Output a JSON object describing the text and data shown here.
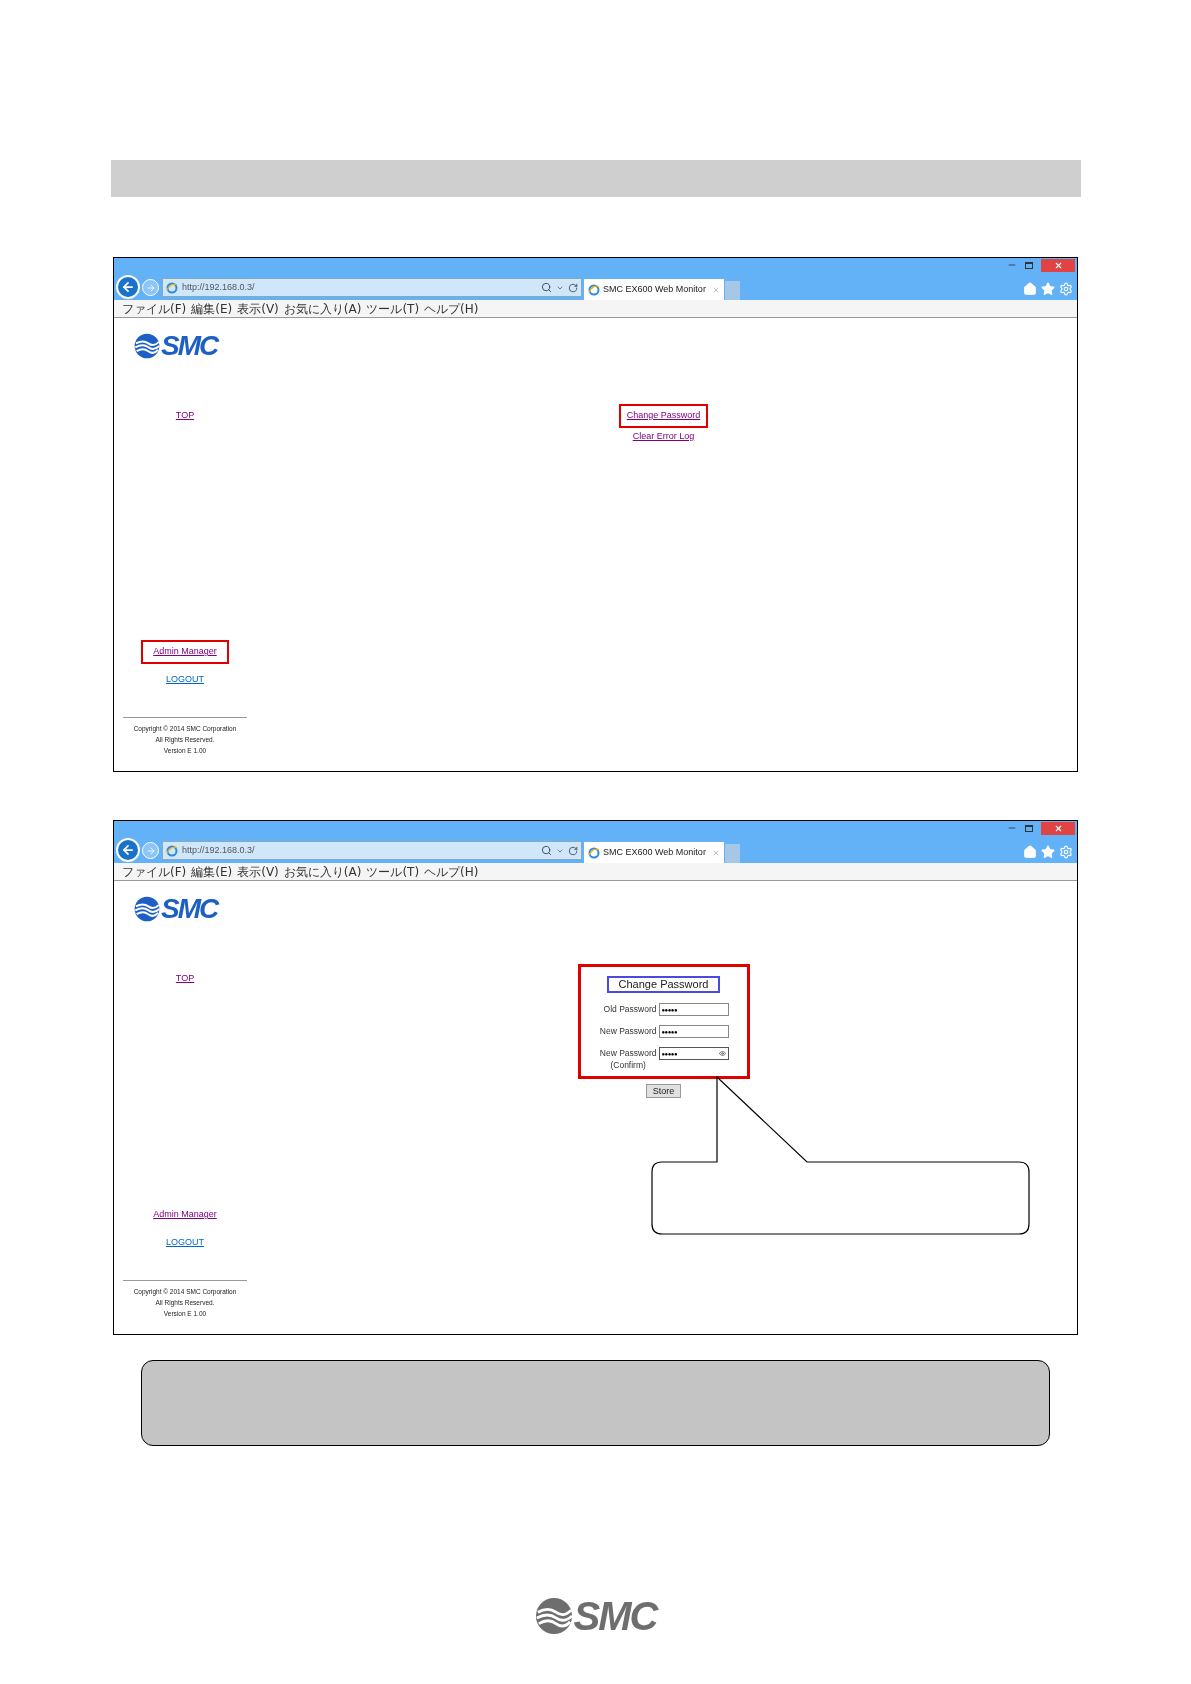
{
  "screenshots": [
    {
      "browser": {
        "address": "http://192.168.0.3/",
        "tab_title": "SMC EX600 Web Monitor",
        "menu": [
          "ファイル(F)",
          "編集(E)",
          "表示(V)",
          "お気に入り(A)",
          "ツール(T)",
          "ヘルプ(H)"
        ]
      },
      "logo": "SMC",
      "nav_top": [
        {
          "label": "TOP",
          "visited": true,
          "highlighted": false
        }
      ],
      "nav_bottom": [
        {
          "label": "Admin Manager",
          "visited": true,
          "highlighted": true
        },
        {
          "label": "LOGOUT",
          "visited": false,
          "highlighted": false
        }
      ],
      "content": {
        "kind": "links",
        "links": [
          {
            "label": "Change Password",
            "highlighted": true
          },
          {
            "label": "Clear Error Log",
            "highlighted": false
          }
        ]
      },
      "copyright": [
        "Copyright © 2014 SMC Corporation",
        "All Rights Reserved.",
        "Version E 1.00"
      ],
      "callout": false
    },
    {
      "browser": {
        "address": "http://192.168.0.3/",
        "tab_title": "SMC EX600 Web Monitor",
        "menu": [
          "ファイル(F)",
          "編集(E)",
          "表示(V)",
          "お気に入り(A)",
          "ツール(T)",
          "ヘルプ(H)"
        ]
      },
      "logo": "SMC",
      "nav_top": [
        {
          "label": "TOP",
          "visited": true,
          "highlighted": false
        }
      ],
      "nav_bottom": [
        {
          "label": "Admin Manager",
          "visited": true,
          "highlighted": false
        },
        {
          "label": "LOGOUT",
          "visited": false,
          "highlighted": false
        }
      ],
      "content": {
        "kind": "form",
        "highlighted": true,
        "title": "Change Password",
        "fields": [
          {
            "label": "Old Password",
            "value": "●●●●●",
            "focused": false
          },
          {
            "label": "New Password",
            "value": "●●●●●",
            "focused": false
          },
          {
            "label": "New Password",
            "sublabel": "(Confirm)",
            "value": "●●●●●",
            "focused": true
          }
        ],
        "button": "Store"
      },
      "copyright": [
        "Copyright © 2014 SMC Corporation",
        "All Rights Reserved.",
        "Version E 1.00"
      ],
      "callout": true
    }
  ],
  "footer_logo": "SMC"
}
